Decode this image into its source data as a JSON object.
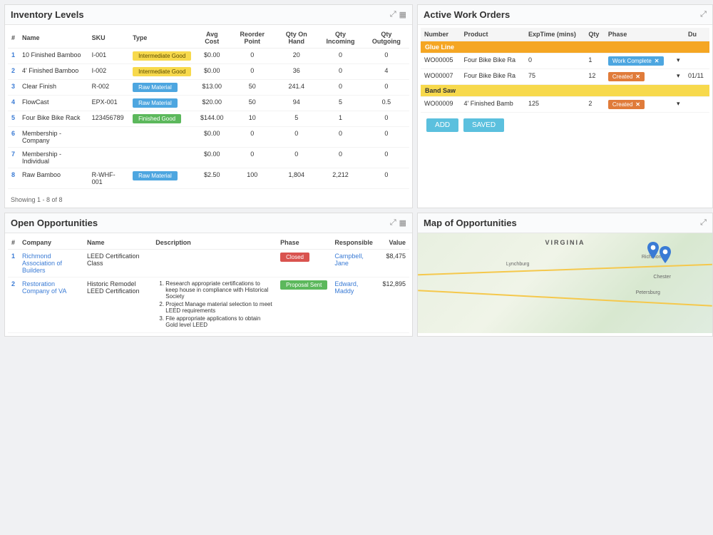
{
  "panels": {
    "inventory": {
      "title": "Inventory Levels",
      "columns": [
        "#",
        "Name",
        "SKU",
        "Type",
        "Avg Cost",
        "Reorder Point",
        "Qty On Hand",
        "Qty Incoming",
        "Qty Outgoing"
      ],
      "rows": [
        {
          "n": "1",
          "name": "10 Finished Bamboo",
          "sku": "I-001",
          "type": "Intermediate Good",
          "type_color": "b-yellow",
          "avg": "$0.00",
          "rp": "0",
          "oh": "20",
          "inc": "0",
          "out": "0"
        },
        {
          "n": "2",
          "name": "4' Finished Bamboo",
          "sku": "I-002",
          "type": "Intermediate Good",
          "type_color": "b-yellow",
          "avg": "$0.00",
          "rp": "0",
          "oh": "36",
          "inc": "0",
          "out": "4"
        },
        {
          "n": "3",
          "name": "Clear Finish",
          "sku": "R-002",
          "type": "Raw Material",
          "type_color": "b-blue",
          "avg": "$13.00",
          "rp": "50",
          "oh": "241.4",
          "inc": "0",
          "out": "0"
        },
        {
          "n": "4",
          "name": "FlowCast",
          "sku": "EPX-001",
          "type": "Raw Material",
          "type_color": "b-blue",
          "avg": "$20.00",
          "rp": "50",
          "oh": "94",
          "inc": "5",
          "out": "0.5"
        },
        {
          "n": "5",
          "name": "Four Bike Bike Rack",
          "sku": "123456789",
          "type": "Finished Good",
          "type_color": "b-green",
          "avg": "$144.00",
          "rp": "10",
          "oh": "5",
          "inc": "1",
          "out": "0"
        },
        {
          "n": "6",
          "name": "Membership - Company",
          "sku": "",
          "type": "",
          "type_color": "",
          "avg": "$0.00",
          "rp": "0",
          "oh": "0",
          "inc": "0",
          "out": "0"
        },
        {
          "n": "7",
          "name": "Membership - Individual",
          "sku": "",
          "type": "",
          "type_color": "",
          "avg": "$0.00",
          "rp": "0",
          "oh": "0",
          "inc": "0",
          "out": "0"
        },
        {
          "n": "8",
          "name": "Raw Bamboo",
          "sku": "R-WHF-001",
          "type": "Raw Material",
          "type_color": "b-blue",
          "avg": "$2.50",
          "rp": "100",
          "oh": "1,804",
          "inc": "2,212",
          "out": "0"
        }
      ],
      "pager": "Showing 1 - 8 of 8"
    },
    "workorders": {
      "title": "Active Work Orders",
      "columns": [
        "Number",
        "Product",
        "ExpTime (mins)",
        "Qty",
        "Phase",
        "",
        "Du"
      ],
      "groups": [
        {
          "name": "Glue Line",
          "style": "orange",
          "rows": [
            {
              "num": "WO00005",
              "product": "Four Bike Bike Ra",
              "exp": "0",
              "qty": "1",
              "phase": "Work Complete",
              "phase_color": "b-blue",
              "due": ""
            },
            {
              "num": "WO00007",
              "product": "Four Bike Bike Ra",
              "exp": "75",
              "qty": "12",
              "phase": "Created",
              "phase_color": "b-orange",
              "due": "01/11"
            }
          ]
        },
        {
          "name": "Band Saw",
          "style": "",
          "rows": [
            {
              "num": "WO00009",
              "product": "4' Finished Bamb",
              "exp": "125",
              "qty": "2",
              "phase": "Created",
              "phase_color": "b-orange",
              "due": ""
            }
          ]
        }
      ],
      "buttons": {
        "add": "ADD",
        "saved": "SAVED"
      }
    },
    "opportunities": {
      "title": "Open Opportunities",
      "columns": [
        "#",
        "Company",
        "Name",
        "Description",
        "Phase",
        "Responsible",
        "Value"
      ],
      "rows": [
        {
          "n": "1",
          "company": "Richmond Association of Builders",
          "name": "LEED Certification Class",
          "desc": "",
          "phase": "Closed",
          "phase_color": "b-red",
          "resp": "Campbell, Jane",
          "value": "$8,475"
        },
        {
          "n": "2",
          "company": "Restoration Company of VA",
          "name": "Historic Remodel LEED Certification",
          "desc_list": [
            "Research appropriate certifications to keep house in compliance with Historical Society",
            "Project Manage material selection to meet LEED requirements",
            "File appropriate applications to obtain Gold level LEED"
          ],
          "phase": "Proposal Sent",
          "phase_color": "b-green",
          "resp": "Edward, Maddy",
          "value": "$12,895"
        }
      ]
    },
    "map": {
      "title": "Map of Opportunities",
      "region": "VIRGINIA",
      "cities": [
        "Lynchburg",
        "Richmond",
        "Chester",
        "Petersburg"
      ]
    }
  }
}
